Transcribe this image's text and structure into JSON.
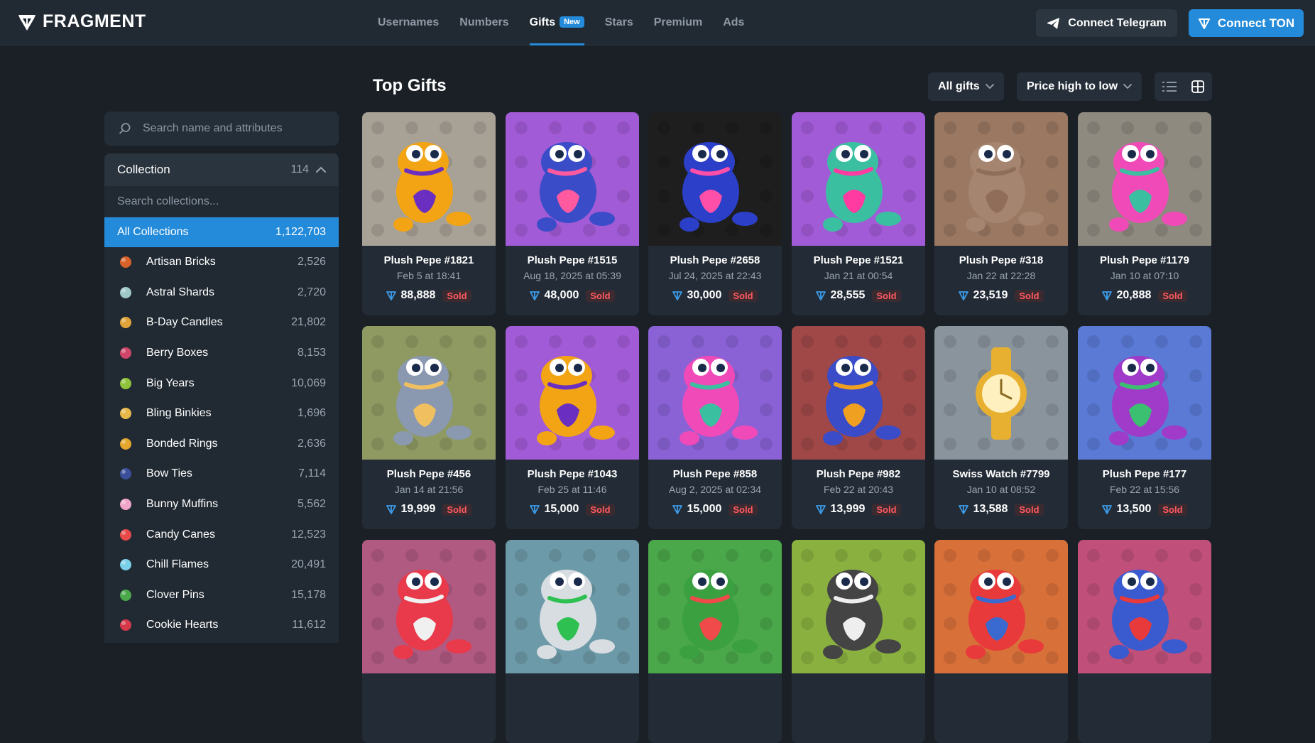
{
  "header": {
    "logo_text": "FRAGMENT",
    "nav": [
      {
        "label": "Usernames"
      },
      {
        "label": "Numbers"
      },
      {
        "label": "Gifts",
        "badge": "New",
        "active": true
      },
      {
        "label": "Stars"
      },
      {
        "label": "Premium"
      },
      {
        "label": "Ads"
      }
    ],
    "connect_telegram": "Connect Telegram",
    "connect_ton": "Connect TON"
  },
  "sidebar": {
    "search_placeholder": "Search name and attributes",
    "collection_title": "Collection",
    "collection_count": "114",
    "collection_search_placeholder": "Search collections...",
    "all_label": "All Collections",
    "all_count": "1,122,703",
    "items": [
      {
        "label": "Artisan Bricks",
        "count": "2,526",
        "icon": "brick-icon",
        "color": "#d9622b"
      },
      {
        "label": "Astral Shards",
        "count": "2,720",
        "icon": "crystal-icon",
        "color": "#9fc8c8"
      },
      {
        "label": "B-Day Candles",
        "count": "21,802",
        "icon": "candles-icon",
        "color": "#e0a23a"
      },
      {
        "label": "Berry Boxes",
        "count": "8,153",
        "icon": "berry-icon",
        "color": "#d0456a"
      },
      {
        "label": "Big Years",
        "count": "10,069",
        "icon": "big-years-icon",
        "color": "#8fc43a"
      },
      {
        "label": "Bling Binkies",
        "count": "1,696",
        "icon": "binky-icon",
        "color": "#e6b84a"
      },
      {
        "label": "Bonded Rings",
        "count": "2,636",
        "icon": "ring-icon",
        "color": "#e4a62c"
      },
      {
        "label": "Bow Ties",
        "count": "7,114",
        "icon": "bowtie-icon",
        "color": "#3a4f9a"
      },
      {
        "label": "Bunny Muffins",
        "count": "5,562",
        "icon": "muffin-icon",
        "color": "#f0a6c8"
      },
      {
        "label": "Candy Canes",
        "count": "12,523",
        "icon": "candy-cane-icon",
        "color": "#e84a4a"
      },
      {
        "label": "Chill Flames",
        "count": "20,491",
        "icon": "flame-icon",
        "color": "#7ad0e8"
      },
      {
        "label": "Clover Pins",
        "count": "15,178",
        "icon": "clover-icon",
        "color": "#4aa84a"
      },
      {
        "label": "Cookie Hearts",
        "count": "11,612",
        "icon": "cookie-heart-icon",
        "color": "#d63a4a"
      }
    ]
  },
  "main": {
    "title": "Top Gifts",
    "filter_label": "All gifts",
    "sort_label": "Price high to low",
    "cards": [
      {
        "name": "Plush Pepe #1821",
        "date": "Feb 5 at 18:41",
        "price": "88,888",
        "status": "Sold",
        "bg": "#a7a196",
        "body": "#f2a414",
        "accent": "#6a2fc0"
      },
      {
        "name": "Plush Pepe #1515",
        "date": "Aug 18, 2025 at 05:39",
        "price": "48,000",
        "status": "Sold",
        "bg": "#a25bd6",
        "body": "#3a4cc8",
        "accent": "#ff5aa0"
      },
      {
        "name": "Plush Pepe #2658",
        "date": "Jul 24, 2025 at 22:43",
        "price": "30,000",
        "status": "Sold",
        "bg": "#1e1e1e",
        "body": "#2c3fc9",
        "accent": "#ff4fa8"
      },
      {
        "name": "Plush Pepe #1521",
        "date": "Jan 21 at 00:54",
        "price": "28,555",
        "status": "Sold",
        "bg": "#a25bd6",
        "body": "#3ac0a0",
        "accent": "#ff3aa0"
      },
      {
        "name": "Plush Pepe #318",
        "date": "Jan 22 at 22:28",
        "price": "23,519",
        "status": "Sold",
        "bg": "#9a7862",
        "body": "#a58570",
        "accent": "#8f6d58"
      },
      {
        "name": "Plush Pepe #1179",
        "date": "Jan 10 at 07:10",
        "price": "20,888",
        "status": "Sold",
        "bg": "#8e8a80",
        "body": "#f04ab8",
        "accent": "#3ac0a0"
      },
      {
        "name": "Plush Pepe #456",
        "date": "Jan 14 at 21:56",
        "price": "19,999",
        "status": "Sold",
        "bg": "#8e9a62",
        "body": "#8a98b0",
        "accent": "#f0c060"
      },
      {
        "name": "Plush Pepe #1043",
        "date": "Feb 25 at 11:46",
        "price": "15,000",
        "status": "Sold",
        "bg": "#a25bd6",
        "body": "#f2a414",
        "accent": "#6a2fc0"
      },
      {
        "name": "Plush Pepe #858",
        "date": "Aug 2, 2025 at 02:34",
        "price": "15,000",
        "status": "Sold",
        "bg": "#8a62d6",
        "body": "#f04ab8",
        "accent": "#3ac0a0"
      },
      {
        "name": "Plush Pepe #982",
        "date": "Feb 22 at 20:43",
        "price": "13,999",
        "status": "Sold",
        "bg": "#a04848",
        "body": "#3a4cc8",
        "accent": "#f0a020"
      },
      {
        "name": "Swiss Watch #7799",
        "date": "Jan 10 at 08:52",
        "price": "13,588",
        "status": "Sold",
        "bg": "#8a949c",
        "body": "#e8b030",
        "accent": "#fff0c0"
      },
      {
        "name": "Plush Pepe #177",
        "date": "Feb 22 at 15:56",
        "price": "13,500",
        "status": "Sold",
        "bg": "#5a7ad6",
        "body": "#a03ac8",
        "accent": "#3ac070"
      },
      {
        "name": "",
        "date": "",
        "price": "",
        "status": "",
        "bg": "#b05a82",
        "body": "#e83a4a",
        "accent": "#f0f0f0"
      },
      {
        "name": "",
        "date": "",
        "price": "",
        "status": "",
        "bg": "#6c9aa8",
        "body": "#d8dde2",
        "accent": "#2ec050"
      },
      {
        "name": "",
        "date": "",
        "price": "",
        "status": "",
        "bg": "#4aa84a",
        "body": "#3aa040",
        "accent": "#f04a4a"
      },
      {
        "name": "",
        "date": "",
        "price": "",
        "status": "",
        "bg": "#8ab040",
        "body": "#444444",
        "accent": "#eeeeee"
      },
      {
        "name": "",
        "date": "",
        "price": "",
        "status": "",
        "bg": "#d8703a",
        "body": "#e83a3a",
        "accent": "#3a6ad0"
      },
      {
        "name": "",
        "date": "",
        "price": "",
        "status": "",
        "bg": "#c0507a",
        "body": "#3a5ad0",
        "accent": "#e83a3a"
      }
    ]
  },
  "colors": {
    "accent": "#248bda",
    "sold": "#ff5a5f",
    "ton": "#3d9be9"
  }
}
